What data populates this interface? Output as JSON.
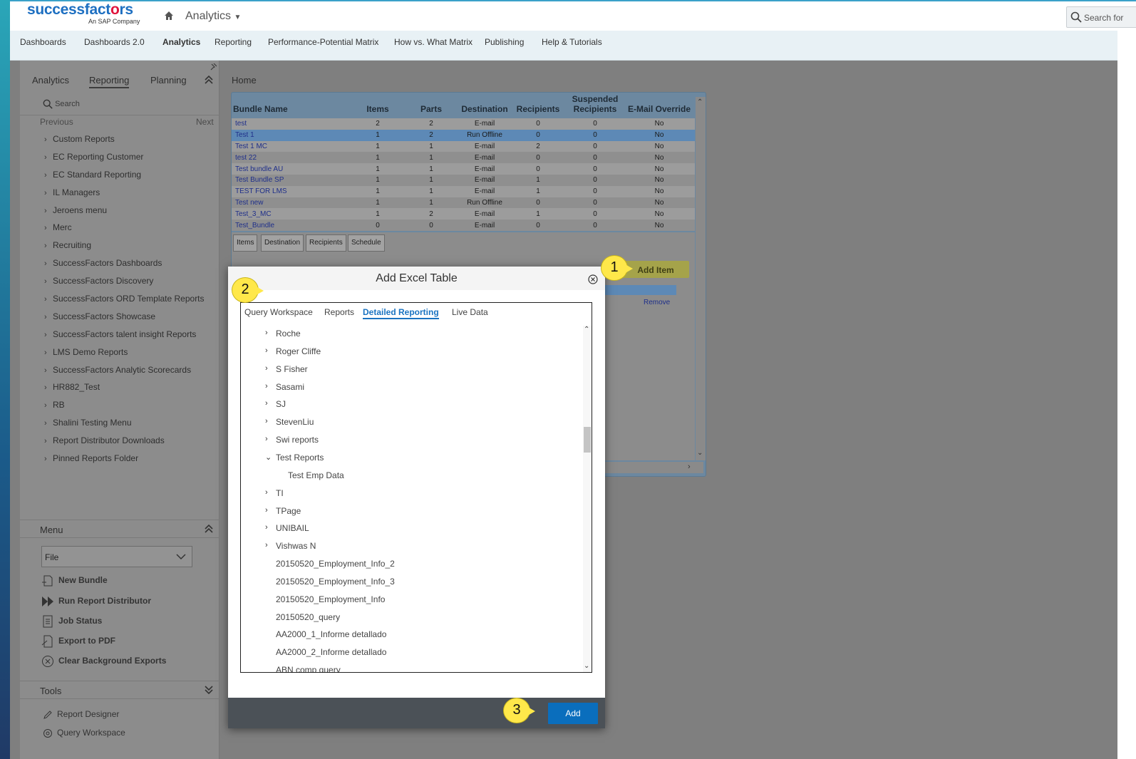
{
  "brand": {
    "word": "successfactors",
    "tagline": "An SAP Company"
  },
  "header": {
    "app_title": "Analytics",
    "search_placeholder": "Search for"
  },
  "nav": [
    "Dashboards",
    "Dashboards 2.0",
    "Analytics",
    "Reporting",
    "Performance-Potential Matrix",
    "How vs. What Matrix",
    "Publishing",
    "Help & Tutorials"
  ],
  "nav_active": "Analytics",
  "sidebar": {
    "tabs": [
      "Analytics",
      "Reporting",
      "Planning"
    ],
    "active_tab": "Reporting",
    "search_label": "Search",
    "previous": "Previous",
    "next": "Next",
    "folders": [
      "Custom Reports",
      "EC Reporting Customer",
      "EC Standard Reporting",
      "IL Managers",
      "Jeroens menu",
      "Merc",
      "Recruiting",
      "SuccessFactors Dashboards",
      "SuccessFactors Discovery",
      "SuccessFactors ORD Template Reports",
      "SuccessFactors Showcase",
      "SuccessFactors talent insight Reports",
      "LMS Demo Reports",
      "SuccessFactors Analytic Scorecards",
      "HR882_Test",
      "RB",
      "Shalini Testing Menu",
      "Report Distributor Downloads",
      "Pinned Reports Folder"
    ],
    "menu_label": "Menu",
    "file_select": "File",
    "menu_items": [
      "New Bundle",
      "Run Report Distributor",
      "Job Status",
      "Export to PDF",
      "Clear Background Exports"
    ],
    "tools_label": "Tools",
    "tools_items": [
      "Report Designer",
      "Query Workspace"
    ]
  },
  "content": {
    "breadcrumb": "Home",
    "columns": [
      "Bundle Name",
      "Items",
      "Parts",
      "Destination",
      "Recipients",
      "Suspended Recipients",
      "E-Mail Override"
    ],
    "rows": [
      [
        "test",
        "2",
        "2",
        "E-mail",
        "0",
        "0",
        "No"
      ],
      [
        "Test 1",
        "1",
        "2",
        "Run Offline",
        "0",
        "0",
        "No"
      ],
      [
        "Test 1 MC",
        "1",
        "1",
        "E-mail",
        "2",
        "0",
        "No"
      ],
      [
        "test 22",
        "1",
        "1",
        "E-mail",
        "0",
        "0",
        "No"
      ],
      [
        "Test bundle AU",
        "1",
        "1",
        "E-mail",
        "0",
        "0",
        "No"
      ],
      [
        "Test Bundle SP",
        "1",
        "1",
        "E-mail",
        "1",
        "0",
        "No"
      ],
      [
        "TEST FOR LMS",
        "1",
        "1",
        "E-mail",
        "1",
        "0",
        "No"
      ],
      [
        "Test new",
        "1",
        "1",
        "Run Offline",
        "0",
        "0",
        "No"
      ],
      [
        "Test_3_MC",
        "1",
        "2",
        "E-mail",
        "1",
        "0",
        "No"
      ],
      [
        "Test_Bundle",
        "0",
        "0",
        "E-mail",
        "0",
        "0",
        "No"
      ]
    ],
    "subtabs": [
      "Items",
      "Destination",
      "Recipients",
      "Schedule"
    ],
    "add_item": "Add Item",
    "remove": "Remove"
  },
  "dialog": {
    "title": "Add Excel Table",
    "tabs": [
      "Query Workspace",
      "Reports",
      "Detailed Reporting",
      "Live Data"
    ],
    "active_tab": "Detailed Reporting",
    "tree": [
      {
        "label": "Roche",
        "chev": "›"
      },
      {
        "label": "Roger Cliffe",
        "chev": "›"
      },
      {
        "label": "S Fisher",
        "chev": "›"
      },
      {
        "label": "Sasami",
        "chev": "›"
      },
      {
        "label": "SJ",
        "chev": "›"
      },
      {
        "label": "StevenLiu",
        "chev": "›"
      },
      {
        "label": "Swi reports",
        "chev": "›"
      },
      {
        "label": "Test Reports",
        "chev": "⌄"
      },
      {
        "label": "Test Emp Data",
        "chev": "",
        "child": true
      },
      {
        "label": "TI",
        "chev": "›"
      },
      {
        "label": "TPage",
        "chev": "›"
      },
      {
        "label": "UNIBAIL",
        "chev": "›"
      },
      {
        "label": "Vishwas N",
        "chev": "›"
      },
      {
        "label": "20150520_Employment_Info_2",
        "chev": ""
      },
      {
        "label": "20150520_Employment_Info_3",
        "chev": ""
      },
      {
        "label": "20150520_Employment_Info",
        "chev": ""
      },
      {
        "label": "20150520_query",
        "chev": ""
      },
      {
        "label": "AA2000_1_Informe detallado",
        "chev": ""
      },
      {
        "label": "AA2000_2_Informe detallado",
        "chev": ""
      },
      {
        "label": "ABN comp query",
        "chev": ""
      }
    ],
    "add_button": "Add"
  },
  "callouts": [
    "1",
    "2",
    "3"
  ],
  "colors": {
    "accent": "#1a73c1",
    "add_button": "#0a6ebd",
    "callout": "#ffe84a",
    "brand_blue": "#1d6fc1",
    "heart": "#e0143c"
  }
}
